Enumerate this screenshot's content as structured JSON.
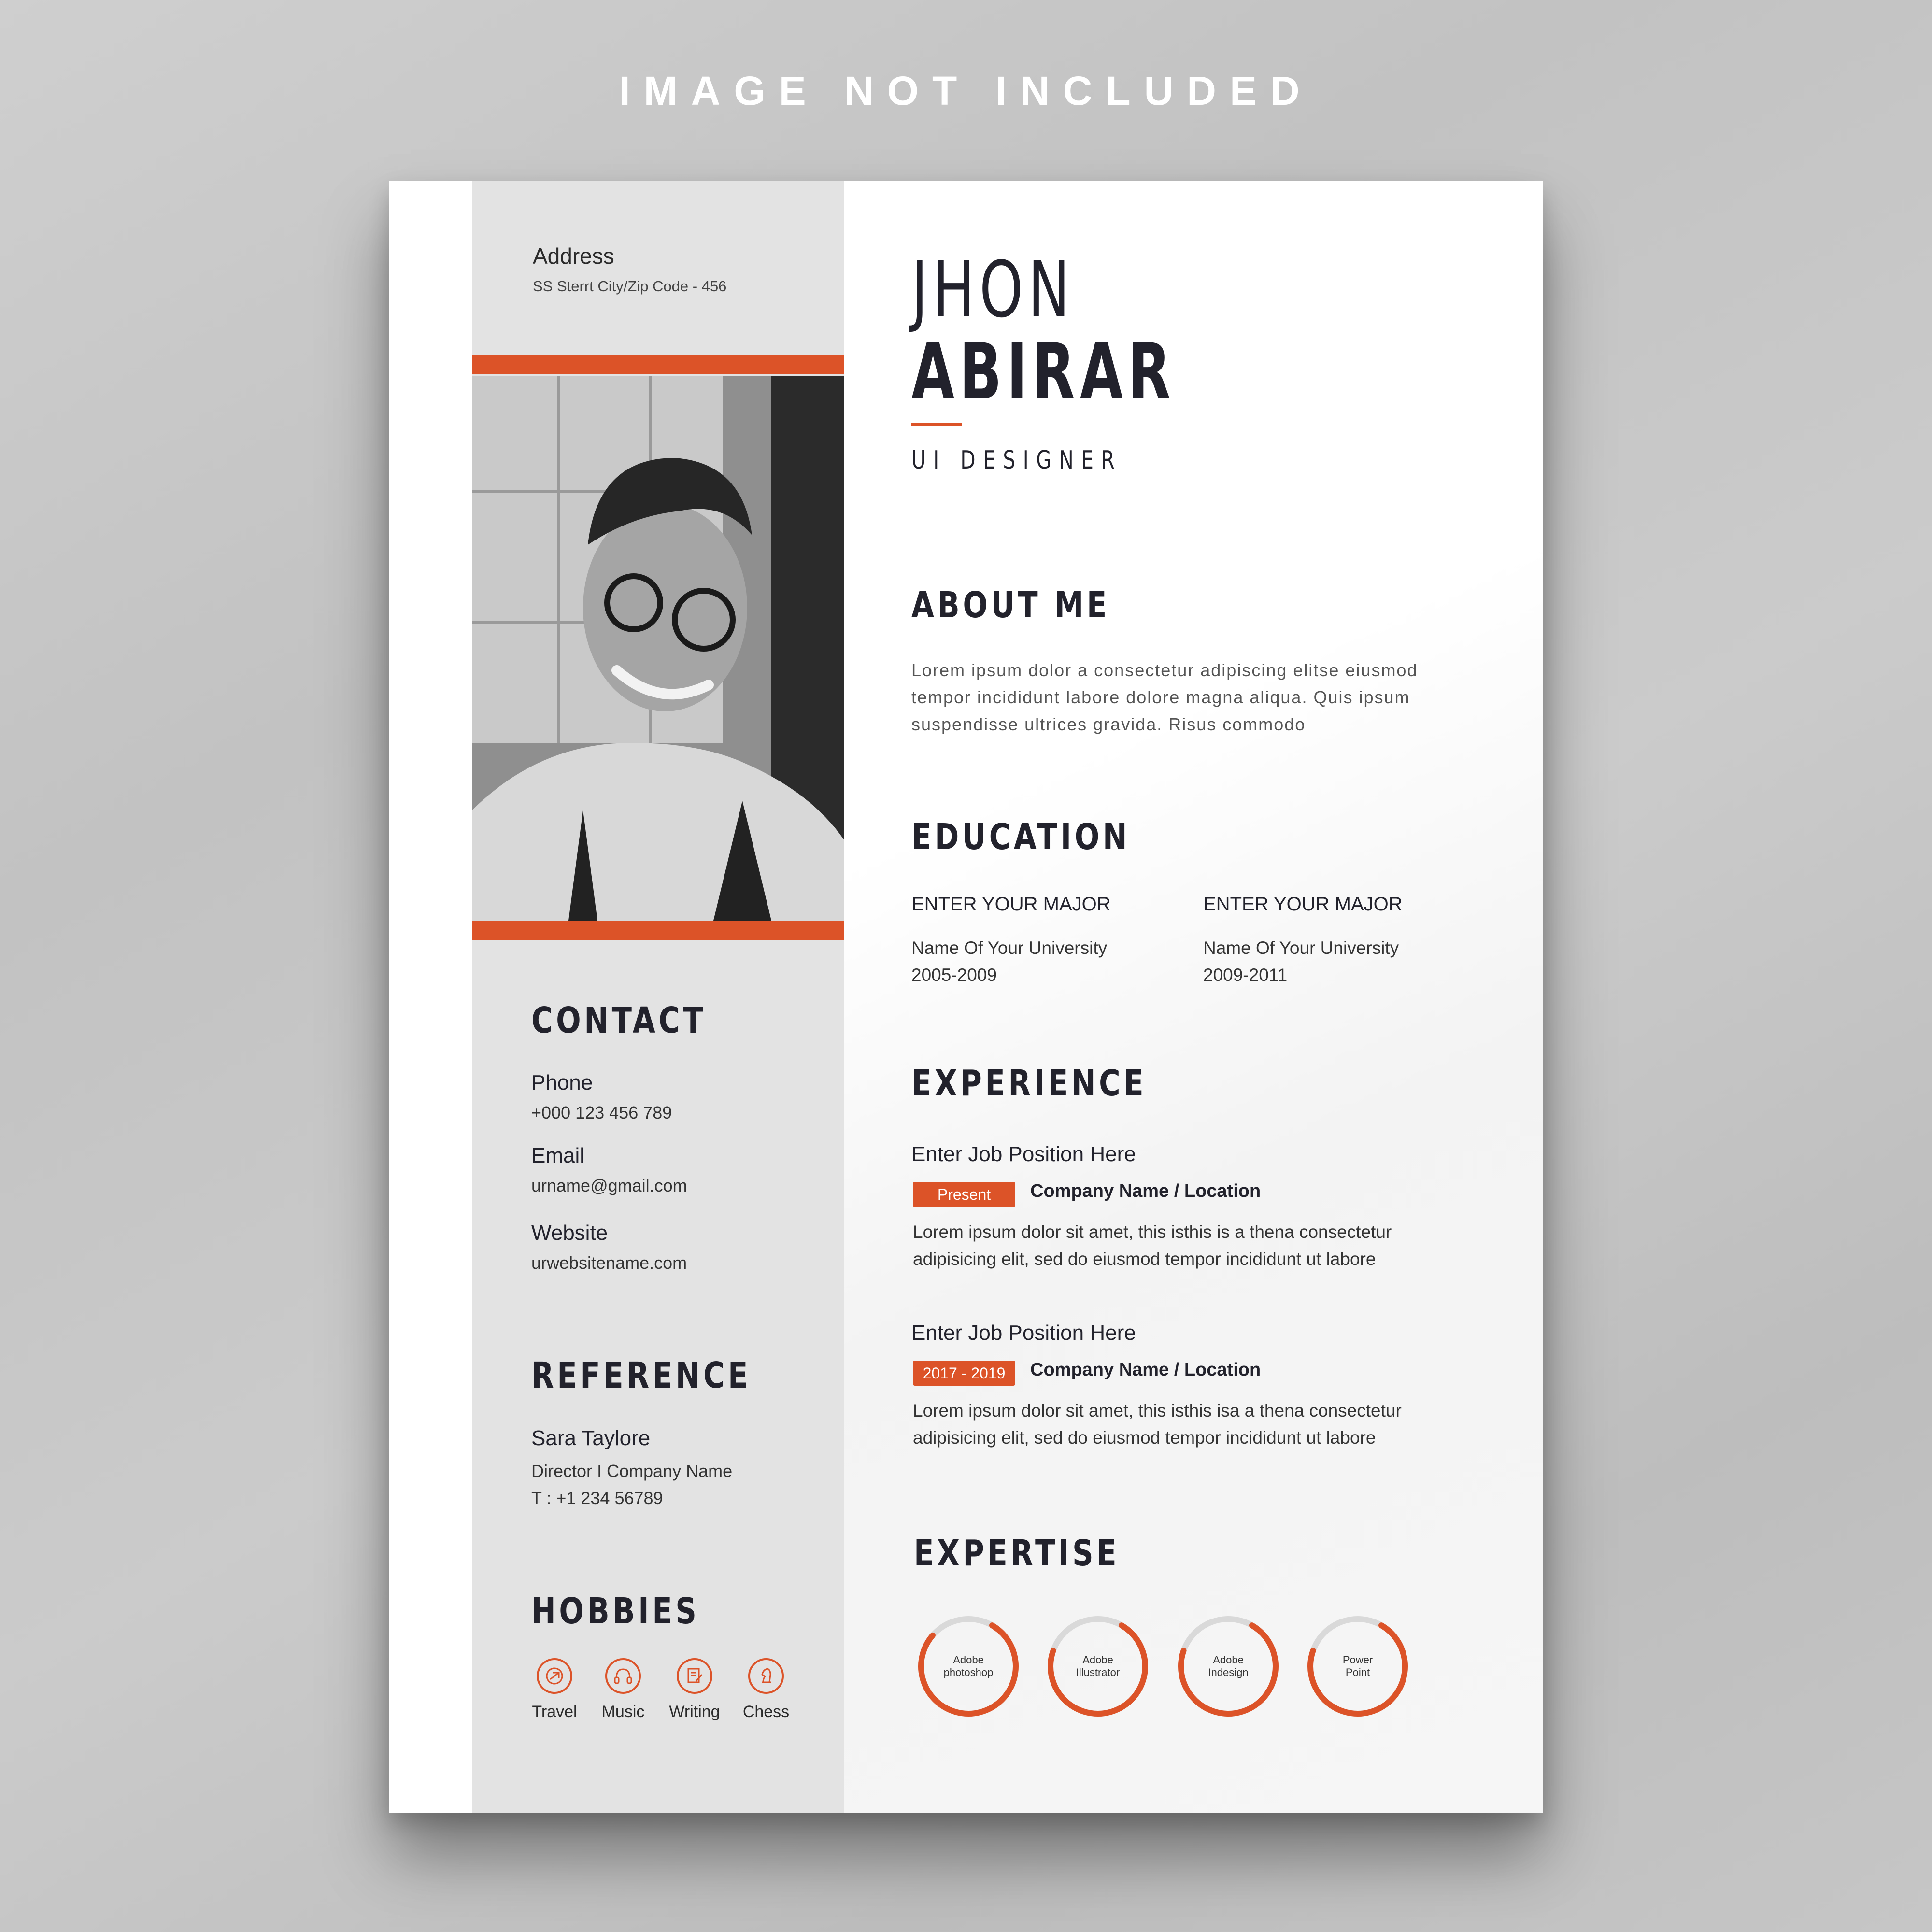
{
  "banner": "IMAGE NOT INCLUDED",
  "colors": {
    "accent": "#dc5328",
    "dark": "#22222c",
    "sidebar": "#e3e3e3"
  },
  "address": {
    "label": "Address",
    "value": "SS Sterrt City/Zip Code - 456"
  },
  "name": {
    "first": "JHON",
    "last": "ABIRAR"
  },
  "role": "UI DESIGNER",
  "about": {
    "title": "ABOUT ME",
    "lines": [
      "Lorem ipsum dolor a consectetur adipiscing elitse eiusmod",
      "tempor incididunt labore dolore magna aliqua. Quis ipsum",
      "suspendisse ultrices gravida. Risus commodo"
    ]
  },
  "education": {
    "title": "EDUCATION",
    "items": [
      {
        "major": "ENTER YOUR MAJOR",
        "university": "Name Of Your University",
        "years": "2005-2009"
      },
      {
        "major": "ENTER YOUR MAJOR",
        "university": "Name Of Your University",
        "years": "2009-2011"
      }
    ]
  },
  "experience": {
    "title": "EXPERIENCE",
    "items": [
      {
        "position": "Enter Job Position Here",
        "period": "Present",
        "company": "Company Name / Location",
        "lines": [
          "Lorem ipsum dolor sit amet, this isthis is a thena  consectetur",
          "adipisicing elit, sed do eiusmod tempor incididunt ut labore"
        ]
      },
      {
        "position": "Enter Job Position Here",
        "period": "2017 - 2019",
        "company": "Company Name / Location",
        "lines": [
          "Lorem ipsum dolor sit amet, this isthis isa a thena  consectetur",
          "adipisicing elit, sed do eiusmod tempor incididunt ut labore"
        ]
      }
    ]
  },
  "expertise": {
    "title": "EXPERTISE",
    "items": [
      {
        "line1": "Adobe",
        "line2": "photoshop",
        "level": 0.78
      },
      {
        "line1": "Adobe",
        "line2": "Illustrator",
        "level": 0.72
      },
      {
        "line1": "Adobe",
        "line2": "Indesign",
        "level": 0.72
      },
      {
        "line1": "Power",
        "line2": "Point",
        "level": 0.72
      }
    ]
  },
  "contact": {
    "title": "CONTACT",
    "phone": {
      "label": "Phone",
      "value": "+000 123 456 789"
    },
    "email": {
      "label": "Email",
      "value": "urname@gmail.com"
    },
    "website": {
      "label": "Website",
      "value": "urwebsitename.com"
    }
  },
  "reference": {
    "title": "REFERENCE",
    "name": "Sara Taylore",
    "role": "Director I Company Name",
    "phone": "T : +1 234 56789"
  },
  "hobbies": {
    "title": "HOBBIES",
    "items": [
      {
        "label": "Travel",
        "icon": "travel-icon"
      },
      {
        "label": "Music",
        "icon": "headphones-icon"
      },
      {
        "label": "Writing",
        "icon": "writing-icon"
      },
      {
        "label": "Chess",
        "icon": "chess-knight-icon"
      }
    ]
  }
}
